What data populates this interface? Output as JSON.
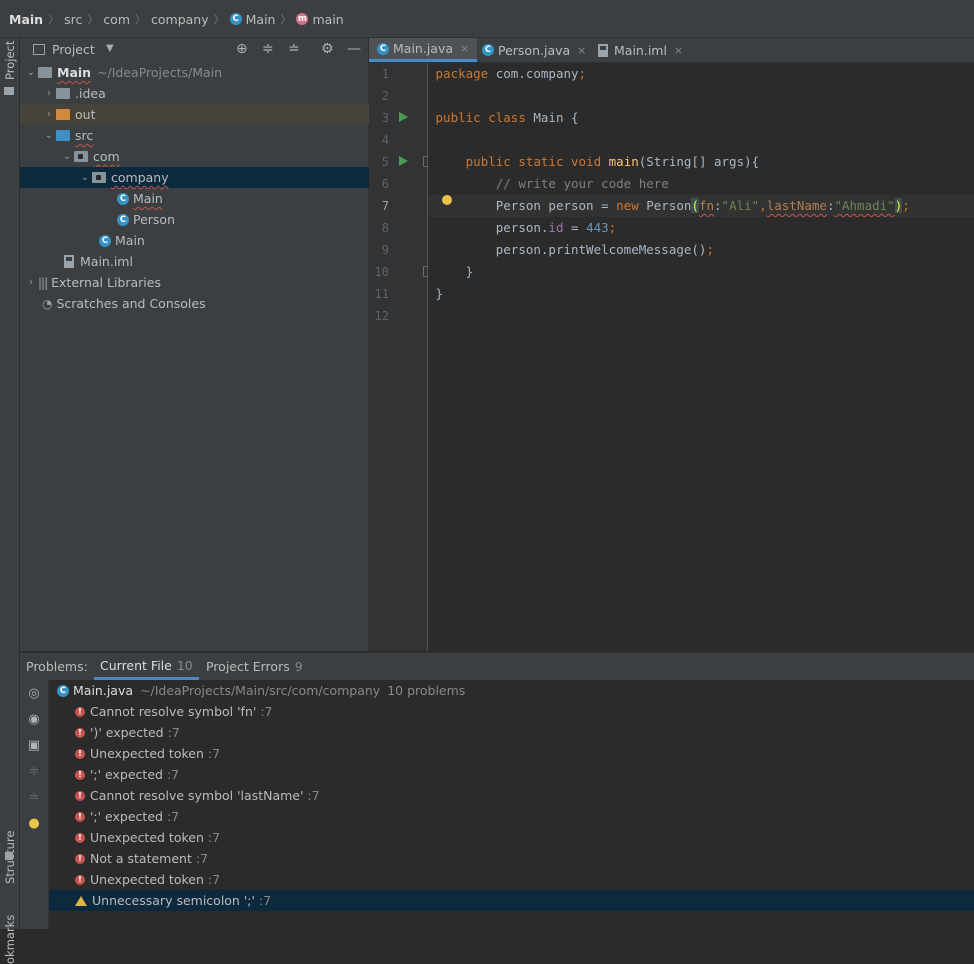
{
  "breadcrumb": {
    "items": [
      {
        "label": "Main",
        "icon": ""
      },
      {
        "label": "src",
        "icon": ""
      },
      {
        "label": "com",
        "icon": ""
      },
      {
        "label": "company",
        "icon": ""
      },
      {
        "label": "Main",
        "icon": "class-icon"
      },
      {
        "label": "main",
        "icon": "method-icon"
      }
    ],
    "separator": "〉"
  },
  "left_strip": {
    "project_label": "Project",
    "structure_label": "Structure",
    "bookmarks_label": "okmarks"
  },
  "project_panel": {
    "title": "Project",
    "tree": {
      "root_label": "Main",
      "root_path": "~/IdeaProjects/Main",
      "idea": ".idea",
      "out": "out",
      "src": "src",
      "com": "com",
      "company": "company",
      "main_class": "Main",
      "person_class": "Person",
      "main_class2": "Main",
      "main_iml": "Main.iml",
      "external": "External Libraries",
      "scratches": "Scratches and Consoles"
    }
  },
  "editor": {
    "tabs": [
      {
        "label": "Main.java",
        "icon": "class-icon",
        "active": true
      },
      {
        "label": "Person.java",
        "icon": "class-icon",
        "active": false
      },
      {
        "label": "Main.iml",
        "icon": "file-icon",
        "active": false
      }
    ],
    "close_glyph": "×",
    "line_numbers": [
      "1",
      "2",
      "3",
      "4",
      "5",
      "6",
      "7",
      "8",
      "9",
      "10",
      "11",
      "12"
    ],
    "current_line": 7,
    "code": {
      "l1_kw": "package",
      "l1_rest": " com.company",
      "l1_semi": ";",
      "l3_kw": "public class",
      "l3_rest": " Main {",
      "l5_indent": "    ",
      "l5_kw": "public static void",
      "l5_sp": " ",
      "l5_fn": "main",
      "l5_rest": "(String[] args){",
      "l6_text": "        // write your code here",
      "l7_a": "        Person person = ",
      "l7_new": "new",
      "l7_b": " Person",
      "l7_open": "(",
      "l7_h1": "fn",
      "l7_colon1": ":",
      "l7_s1": "\"Ali\"",
      "l7_comma": ",",
      "l7_h2": "lastName",
      "l7_colon2": ":",
      "l7_s2": "\"Ahmadi\"",
      "l7_close": ")",
      "l7_semi": ";",
      "l8_a": "        person.",
      "l8_fld": "id",
      "l8_b": " = ",
      "l8_num": "443",
      "l8_semi": ";",
      "l9_a": "        person.printWelcomeMessage()",
      "l9_semi": ";",
      "l10_text": "    }",
      "l11_text": "}"
    }
  },
  "problems": {
    "label": "Problems:",
    "tab_current": "Current File",
    "tab_current_count": "10",
    "tab_project": "Project Errors",
    "tab_project_count": "9",
    "file_name": "Main.java",
    "file_path": "~/IdeaProjects/Main/src/com/company",
    "file_count": "10 problems",
    "items": [
      {
        "type": "error",
        "text": "Cannot resolve symbol 'fn'",
        "line": ":7"
      },
      {
        "type": "error",
        "text": "')' expected",
        "line": ":7"
      },
      {
        "type": "error",
        "text": "Unexpected token",
        "line": ":7"
      },
      {
        "type": "error",
        "text": "';' expected",
        "line": ":7"
      },
      {
        "type": "error",
        "text": "Cannot resolve symbol 'lastName'",
        "line": ":7"
      },
      {
        "type": "error",
        "text": "';' expected",
        "line": ":7"
      },
      {
        "type": "error",
        "text": "Unexpected token",
        "line": ":7"
      },
      {
        "type": "error",
        "text": "Not a statement",
        "line": ":7"
      },
      {
        "type": "error",
        "text": "Unexpected token",
        "line": ":7"
      },
      {
        "type": "warning",
        "text": "Unnecessary semicolon ';'",
        "line": ":7"
      }
    ]
  }
}
